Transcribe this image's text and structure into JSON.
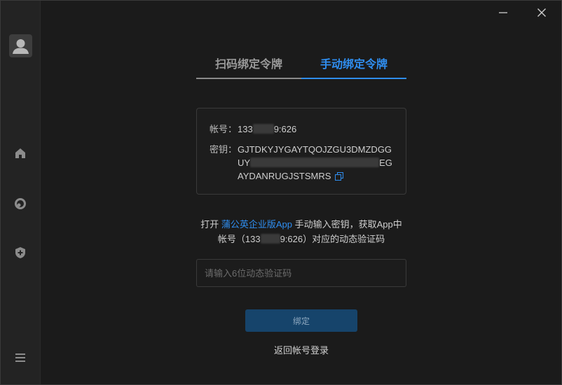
{
  "window": {
    "minimize_icon": "minimize-icon",
    "close_icon": "close-icon"
  },
  "sidebar": {
    "avatar_icon": "user-avatar-icon",
    "items": [
      {
        "name": "home",
        "icon": "home-icon"
      },
      {
        "name": "circle",
        "icon": "circle-icon"
      },
      {
        "name": "shield-add",
        "icon": "shield-plus-icon"
      },
      {
        "name": "menu",
        "icon": "menu-icon"
      }
    ]
  },
  "tabs": [
    {
      "label": "扫码绑定令牌",
      "active": false
    },
    {
      "label": "手动绑定令牌",
      "active": true
    }
  ],
  "account": {
    "account_label": "帐号：",
    "account_prefix": "133",
    "account_suffix": "9:626",
    "secret_label": "密钥：",
    "secret_line1": "GJTDKYJYGAYTQOJZGU3DMZDGG",
    "secret_line2_prefix": "UY",
    "secret_line2_suffix": "EG",
    "secret_line3": "AYDANRUGJSTSMRS",
    "copy_icon": "copy-icon"
  },
  "hint": {
    "prefix": "打开 ",
    "app_link": "蒲公英企业版App",
    "middle": " 手动输入密钥，获取App中",
    "line2_prefix": "帐号（133",
    "line2_suffix": "9:626）对应的动态验证码"
  },
  "code_input": {
    "placeholder": "请输入6位动态验证码",
    "value": ""
  },
  "bind_button": "绑定",
  "back_link": "返回帐号登录",
  "colors": {
    "accent": "#2f8ef0",
    "button_bg": "#16446b",
    "background": "#1b1b1b"
  }
}
